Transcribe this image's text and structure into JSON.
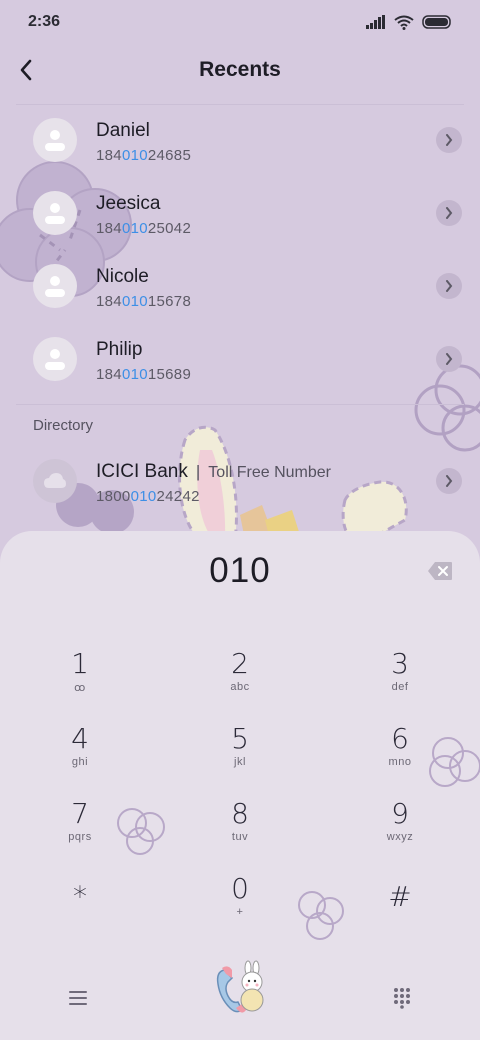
{
  "status_bar": {
    "time": "2:36"
  },
  "header": {
    "title": "Recents"
  },
  "contacts": [
    {
      "name": "Daniel",
      "number_pre": "184",
      "number_match": "010",
      "number_post": "24685"
    },
    {
      "name": "Jeesica",
      "number_pre": "184",
      "number_match": "010",
      "number_post": "25042"
    },
    {
      "name": "Nicole",
      "number_pre": "184",
      "number_match": "010",
      "number_post": "15678"
    },
    {
      "name": "Philip",
      "number_pre": "184",
      "number_match": "010",
      "number_post": "15689"
    }
  ],
  "directory": {
    "label": "Directory",
    "entry": {
      "name": "ICICI Bank",
      "separator": "|",
      "subtitle": "Toll Free Number",
      "number_pre": "1800",
      "number_match": "010",
      "number_post": "24242"
    }
  },
  "dialer": {
    "input": "010",
    "keys": [
      {
        "digit": "1",
        "letters": "ꝏ"
      },
      {
        "digit": "2",
        "letters": "abc"
      },
      {
        "digit": "3",
        "letters": "def"
      },
      {
        "digit": "4",
        "letters": "ghi"
      },
      {
        "digit": "5",
        "letters": "jkl"
      },
      {
        "digit": "6",
        "letters": "mno"
      },
      {
        "digit": "7",
        "letters": "pqrs"
      },
      {
        "digit": "8",
        "letters": "tuv"
      },
      {
        "digit": "9",
        "letters": "wxyz"
      },
      {
        "digit": "*",
        "letters": ""
      },
      {
        "digit": "0",
        "letters": "+"
      },
      {
        "digit": "#",
        "letters": ""
      }
    ]
  },
  "colors": {
    "background": "#d6cadf",
    "sheet": "#e6e0ea",
    "highlight": "#3d8fe6"
  }
}
